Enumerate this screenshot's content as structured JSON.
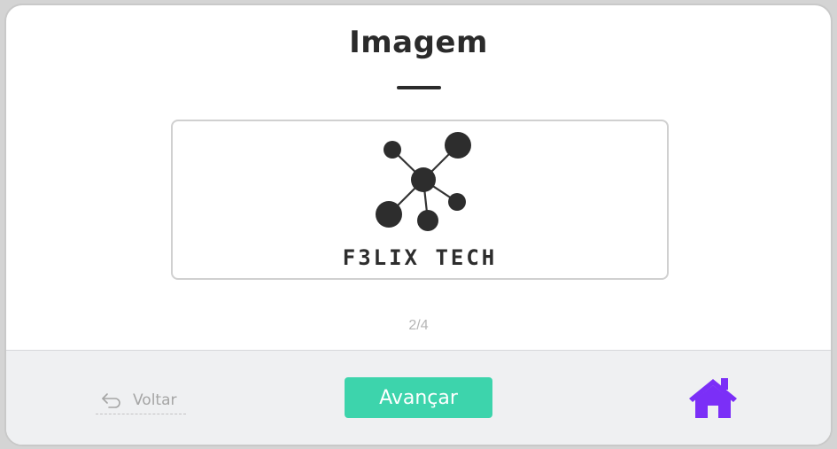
{
  "header": {
    "title": "Imagem"
  },
  "image": {
    "logo_text": "F3LIX TECH",
    "logo_icon": "network-nodes-logo"
  },
  "pager": {
    "text": "2/4"
  },
  "footer": {
    "back_label": "Voltar",
    "back_icon": "undo-arrow-icon",
    "next_label": "Avançar",
    "home_icon": "home-icon"
  },
  "colors": {
    "accent_green": "#3dd4ac",
    "home_purple": "#7b2ff7",
    "title_dark": "#2b2b2b",
    "footer_bg": "#eff0f2"
  }
}
